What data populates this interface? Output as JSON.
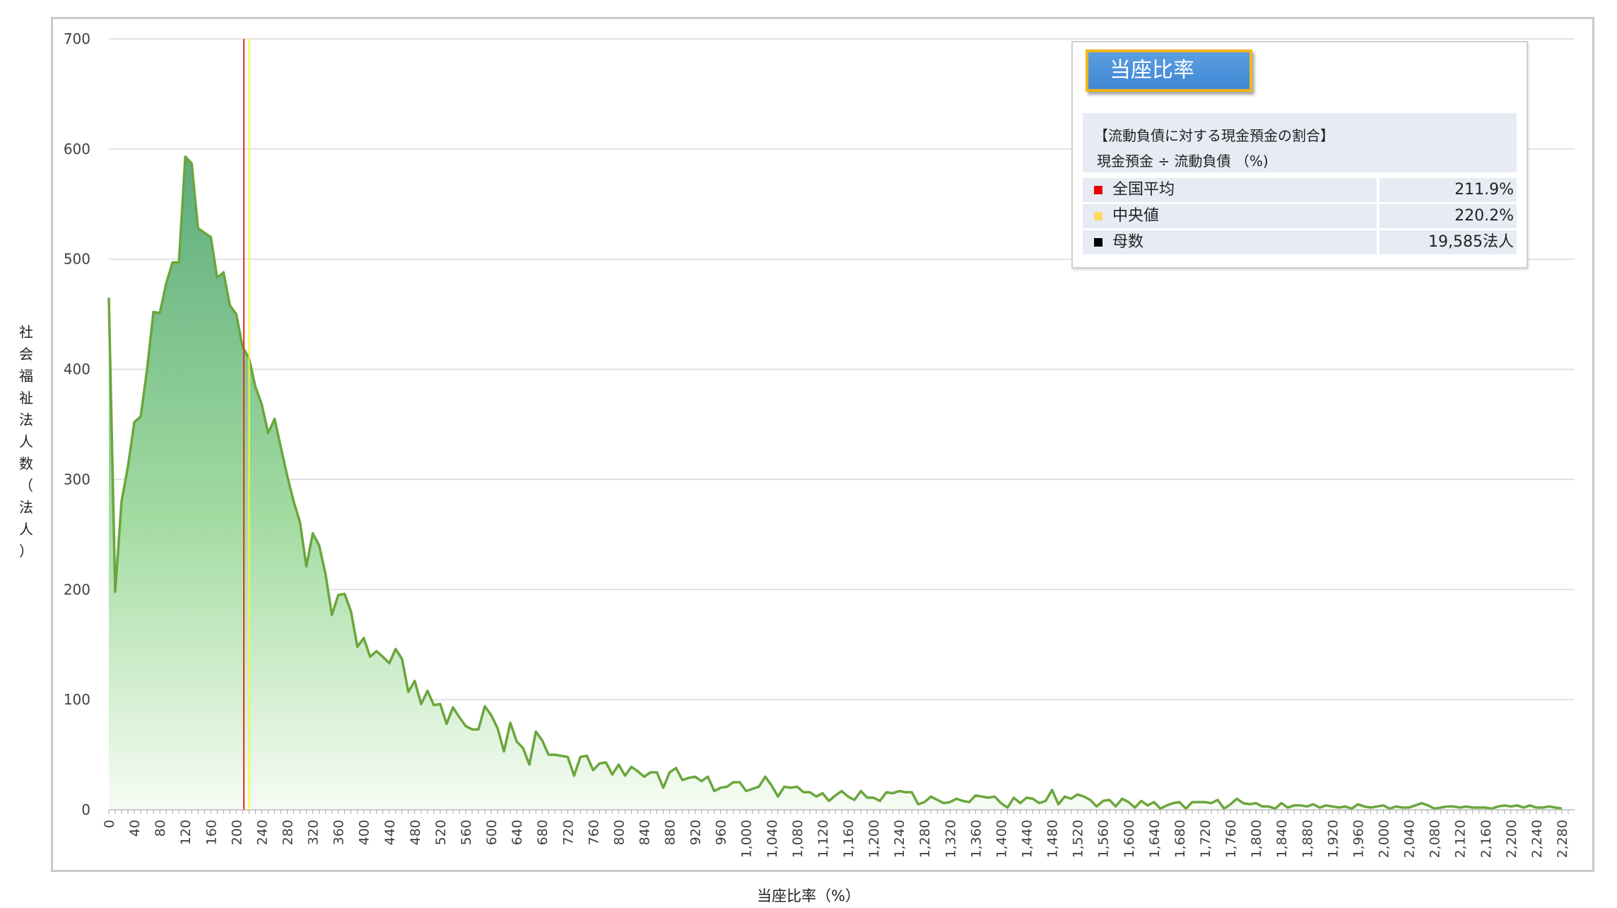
{
  "chart_data": {
    "type": "area",
    "xlabel": "当座比率（%）",
    "ylabel": "社会福祉法人数（法人）",
    "ylim": [
      0,
      700
    ],
    "xlim": [
      0,
      2300
    ],
    "x_step": 10,
    "y_ticks": [
      0,
      100,
      200,
      300,
      400,
      500,
      600,
      700
    ],
    "x_tick_labels": [
      "0",
      "40",
      "80",
      "120",
      "160",
      "200",
      "240",
      "280",
      "320",
      "360",
      "400",
      "440",
      "480",
      "520",
      "560",
      "600",
      "640",
      "680",
      "720",
      "760",
      "800",
      "840",
      "880",
      "920",
      "960",
      "1,000",
      "1,040",
      "1,080",
      "1,120",
      "1,160",
      "1,200",
      "1,240",
      "1,280",
      "1,320",
      "1,360",
      "1,400",
      "1,440",
      "1,480",
      "1,520",
      "1,560",
      "1,600",
      "1,640",
      "1,680",
      "1,720",
      "1,760",
      "1,800",
      "1,840",
      "1,880",
      "1,920",
      "1,960",
      "2,000",
      "2,040",
      "2,080",
      "2,120",
      "2,160",
      "2,200",
      "2,240",
      "2,280"
    ],
    "grid": true,
    "values": [
      465,
      198,
      280,
      312,
      352,
      357,
      400,
      452,
      451,
      478,
      497,
      497,
      593,
      587,
      528,
      524,
      520,
      483,
      488,
      458,
      450,
      420,
      410,
      384,
      368,
      342,
      355,
      329,
      303,
      280,
      261,
      221,
      251,
      240,
      214,
      177,
      195,
      196,
      180,
      148,
      156,
      139,
      144,
      139,
      133,
      146,
      137,
      107,
      117,
      96,
      108,
      95,
      96,
      78,
      93,
      84,
      76,
      73,
      73,
      94,
      86,
      74,
      53,
      79,
      62,
      56,
      41,
      71,
      63,
      50,
      50,
      49,
      48,
      31,
      48,
      49,
      36,
      42,
      43,
      32,
      41,
      31,
      39,
      35,
      30,
      34,
      34,
      20,
      34,
      38,
      27,
      29,
      30,
      26,
      30,
      17,
      20,
      21,
      25,
      25,
      17,
      19,
      21,
      30,
      22,
      12,
      21,
      20,
      21,
      16,
      16,
      12,
      15,
      8,
      13,
      17,
      12,
      9,
      17,
      11,
      11,
      8,
      16,
      15,
      17,
      16,
      16,
      5,
      7,
      12,
      9,
      6,
      7,
      10,
      8,
      7,
      13,
      12,
      11,
      12,
      6,
      2,
      11,
      6,
      11,
      10,
      6,
      8,
      18,
      5,
      12,
      10,
      14,
      12,
      9,
      3,
      8,
      9,
      3,
      10,
      7,
      2,
      8,
      4,
      7,
      1,
      4,
      6,
      7,
      1,
      7,
      7,
      7,
      6,
      9,
      1,
      5,
      10,
      6,
      5,
      6,
      3,
      3,
      1,
      6,
      2,
      4,
      4,
      3,
      5,
      2,
      4,
      3,
      2,
      3,
      1,
      5,
      3,
      2,
      3,
      4,
      1,
      3,
      2,
      2,
      4,
      6,
      4,
      1,
      2,
      3,
      3,
      2,
      3,
      2,
      2,
      2,
      1,
      3,
      4,
      3,
      4,
      2,
      4,
      2,
      2,
      3,
      2,
      1
    ],
    "series": [
      {
        "name": "全国平均",
        "x": 211.9,
        "color": "#e32b2b"
      },
      {
        "name": "中央値",
        "x": 220.2,
        "color": "#f5f542"
      }
    ]
  },
  "legend": {
    "title": "当座比率",
    "description_line1": "【流動負債に対する現金預金の割合】",
    "description_line2": "現金預金 ÷ 流動負債 （%)",
    "rows": [
      {
        "label": "全国平均",
        "value": "211.9%",
        "color": "#e60000"
      },
      {
        "label": "中央値",
        "value": "220.2%",
        "color": "#ffd966"
      },
      {
        "label": "母数",
        "value": "19,585法人",
        "color": "#000000"
      }
    ]
  },
  "colors": {
    "line": "#6aa63c",
    "fill_top": "#63b07a",
    "fill_bottom": "#f4fbf2",
    "grid": "#d9d9d9",
    "axis_text": "#404040"
  }
}
